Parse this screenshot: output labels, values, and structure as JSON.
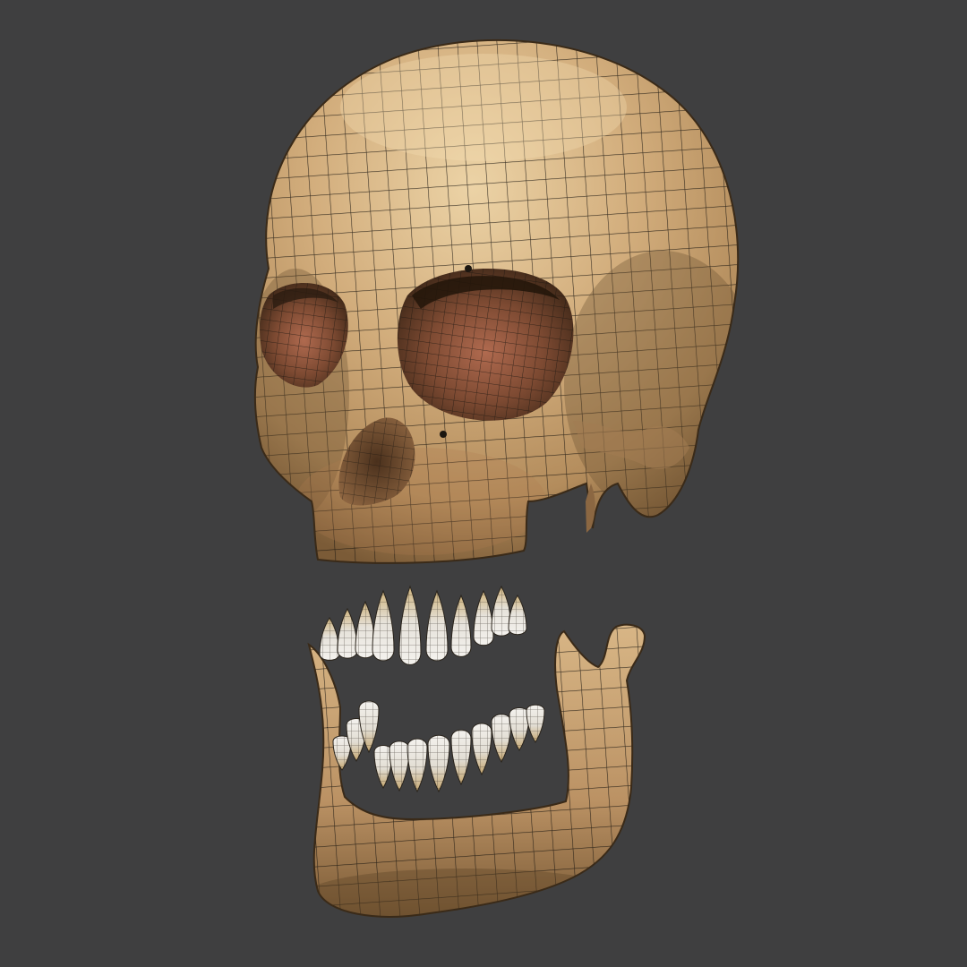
{
  "viewport": {
    "background": "#3f3f40"
  },
  "model": {
    "bone_color": "#c9a273",
    "bone_highlight": "#e4c799",
    "bone_shadow": "#6b4f31",
    "wire_color": "#1b1610",
    "socket_tint": "#9a5a43",
    "tooth_color": "#ece9e4",
    "root_color": "#c6ad78"
  }
}
